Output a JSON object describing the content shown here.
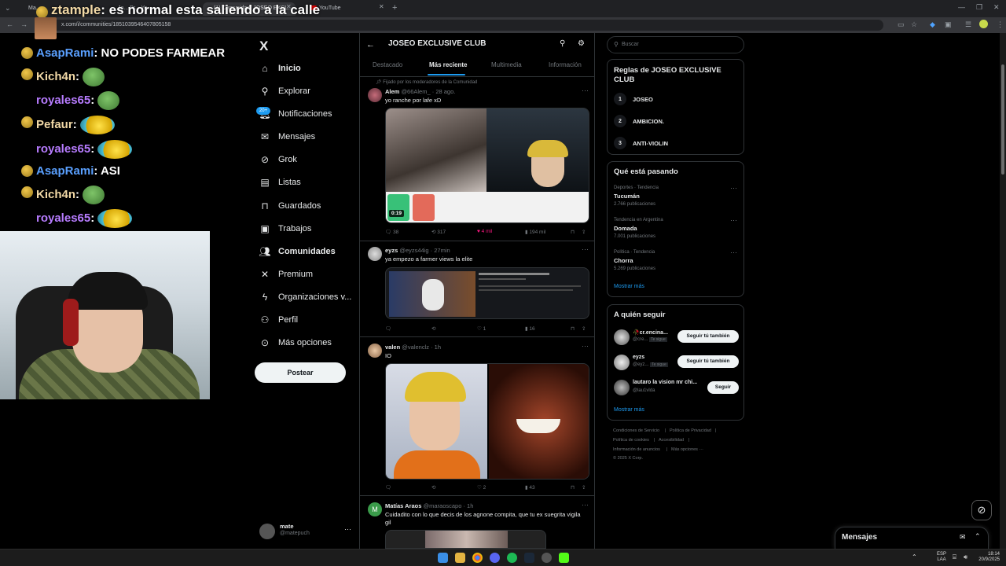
{
  "browser": {
    "tabs": [
      {
        "label": "Ma...",
        "active": false
      },
      {
        "label": "Jo... Pr... Yo...",
        "active": false
      },
      {
        "label": "(1) Comunidad: JOSEO EXCL...",
        "active": true
      },
      {
        "label": "YouTube",
        "active": false
      }
    ],
    "url": "x.com/i/communities/1851039546407805158"
  },
  "stream_overlay": {
    "caption_user": "ztample",
    "caption_text": ": es normal esta saliendo a la calle",
    "chat": [
      {
        "user": "AsapRami",
        "text": ": NO PODES FARMEAR",
        "color": "blue",
        "emote": ""
      },
      {
        "user": "Kich4n",
        "text": ":",
        "color": "gold",
        "emote": "frog"
      },
      {
        "user": "royales65",
        "text": ":",
        "color": "purple",
        "emote": "frog"
      },
      {
        "user": "Pefaur",
        "text": ":",
        "color": "gold",
        "emote": "duck"
      },
      {
        "user": "royales65",
        "text": ":",
        "color": "purple",
        "emote": "duck"
      },
      {
        "user": "AsapRami",
        "text": ": ASI",
        "color": "blue",
        "emote": ""
      },
      {
        "user": "Kich4n",
        "text": ":",
        "color": "gold",
        "emote": "frog"
      },
      {
        "user": "royales65",
        "text": ":",
        "color": "purple",
        "emote": "duck"
      }
    ]
  },
  "nav": {
    "logo": "X",
    "items": [
      {
        "label": "Inicio",
        "icon": "home-icon"
      },
      {
        "label": "Explorar",
        "icon": "search-icon"
      },
      {
        "label": "Notificaciones",
        "icon": "bell-icon"
      },
      {
        "label": "Mensajes",
        "icon": "mail-icon"
      },
      {
        "label": "Grok",
        "icon": "grok-icon"
      },
      {
        "label": "Listas",
        "icon": "list-icon"
      },
      {
        "label": "Guardados",
        "icon": "bookmark-icon"
      },
      {
        "label": "Trabajos",
        "icon": "briefcase-icon"
      },
      {
        "label": "Comunidades",
        "icon": "communities-icon"
      },
      {
        "label": "Premium",
        "icon": "x-icon"
      },
      {
        "label": "Organizaciones v...",
        "icon": "lightning-icon"
      },
      {
        "label": "Perfil",
        "icon": "person-icon"
      },
      {
        "label": "Más opciones",
        "icon": "more-icon"
      }
    ],
    "notif_badge": "20+",
    "post_button": "Postear",
    "account_name": "mate",
    "account_handle": "@matepuch"
  },
  "community": {
    "title": "JOSEO EXCLUSIVE CLUB",
    "tabs": [
      "Destacado",
      "Más reciente",
      "Multimedia",
      "Información"
    ],
    "active_tab": 1,
    "pinned_label": "Fijado por los moderadores de la Comunidad",
    "posts": [
      {
        "name": "Alem",
        "handle": "@66Alem_ · 28 ago.",
        "text": "yo ranche por lafe xD",
        "video_time": "0:19",
        "stats": {
          "replies": "38",
          "reposts": "317",
          "likes": "4 mil",
          "views": "194 mil"
        }
      },
      {
        "name": "eyzs",
        "handle": "@eyzs44ig · 27min",
        "text": "ya empezo a farmer views la elite",
        "stats": {
          "replies": "",
          "reposts": "",
          "likes": "1",
          "views": "16"
        }
      },
      {
        "name": "valen",
        "handle": "@valenclz · 1h",
        "text": "IO",
        "stats": {
          "replies": "",
          "reposts": "",
          "likes": "2",
          "views": "43"
        }
      },
      {
        "name": "Matías Araos",
        "handle": "@maraoscapo · 1h",
        "text": "Cuidadito con lo que decis de los agnone compita, que tu ex suegrita vigila",
        "text2": "gil"
      }
    ]
  },
  "right": {
    "search_placeholder": "Buscar",
    "rules_title": "Reglas de JOSEO EXCLUSIVE CLUB",
    "rules": [
      {
        "num": "1",
        "label": "JOSEO"
      },
      {
        "num": "2",
        "label": "AMBICION."
      },
      {
        "num": "3",
        "label": "ANTI-VIOLIN"
      }
    ],
    "trending_title": "Qué está pasando",
    "trends": [
      {
        "meta": "Deportes · Tendencia",
        "name": "Tucumán",
        "count": "2.766 publicaciones"
      },
      {
        "meta": "Tendencia en Argentina",
        "name": "Domada",
        "count": "7.001 publicaciones"
      },
      {
        "meta": "Política · Tendencia",
        "name": "Chorra",
        "count": "5.269 publicaciones"
      }
    ],
    "show_more": "Mostrar más",
    "who_title": "A quién seguir",
    "who": [
      {
        "name": "🥀cr.encina...",
        "handle": "@cre...",
        "tag": "Te sigue",
        "button": "Seguir tú también"
      },
      {
        "name": "eyzs",
        "handle": "@eyz...",
        "tag": "Te sigue",
        "button": "Seguir tú también"
      },
      {
        "name": "lautaro la vision mr chi...",
        "handle": "@lau1vlda",
        "tag": "",
        "button": "Seguir"
      }
    ],
    "footer": [
      "Condiciones de Servicio",
      "|",
      "Política de Privacidad",
      "|",
      "Política de cookies",
      "|",
      "Accesibilidad",
      "|",
      "Información de anuncios",
      "|",
      "Más opciones ···",
      "© 2025 X Corp."
    ],
    "messages_drawer": "Mensajes"
  },
  "taskbar": {
    "lang": "ESP",
    "lang2": "LAA",
    "time": "18:14",
    "date": "20/9/2025"
  },
  "colors": {
    "accent": "#1d9bf0",
    "like": "#f91880",
    "background": "#000000"
  }
}
